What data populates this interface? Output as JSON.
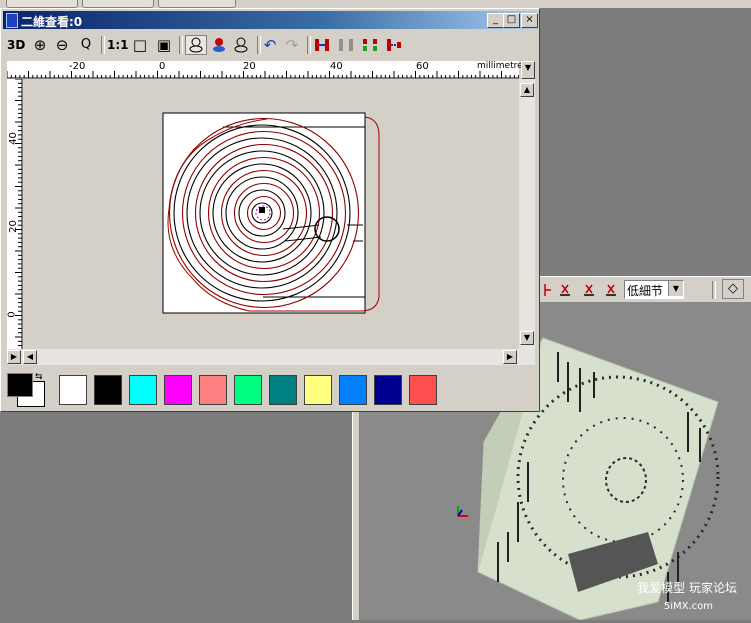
{
  "window": {
    "title": "二維查看:0",
    "minimize_glyph": "_",
    "maximize_glyph": "□",
    "close_glyph": "×"
  },
  "toolbar": {
    "view3d_label": "3D",
    "zoom_in_icon": "⊕",
    "zoom_out_icon": "⊖",
    "zoom_window_icon": "Q",
    "actual_size_label": "1:1",
    "fit_page_icon": "□",
    "fit_all_icon": "▣",
    "undo_icon": "↶",
    "redo_icon": "↷"
  },
  "ruler": {
    "unit": "millimetres",
    "h_ticks": [
      "-20",
      "0",
      "20",
      "40",
      "60"
    ],
    "v_ticks": [
      "40",
      "20",
      "0"
    ]
  },
  "palette": {
    "colors": [
      "#ffffff",
      "#000000",
      "#00ffff",
      "#ff00ff",
      "#ff8080",
      "#00ff80",
      "#008080",
      "#ffff80",
      "#0080ff",
      "#000090",
      "#ff5050"
    ],
    "foreground": "#000000",
    "background": "#ffffff"
  },
  "right_toolbar": {
    "detail_select_value": "低細节"
  },
  "watermark": {
    "line1": "我爱模型 玩家论坛",
    "line2": "5iMX.com"
  }
}
